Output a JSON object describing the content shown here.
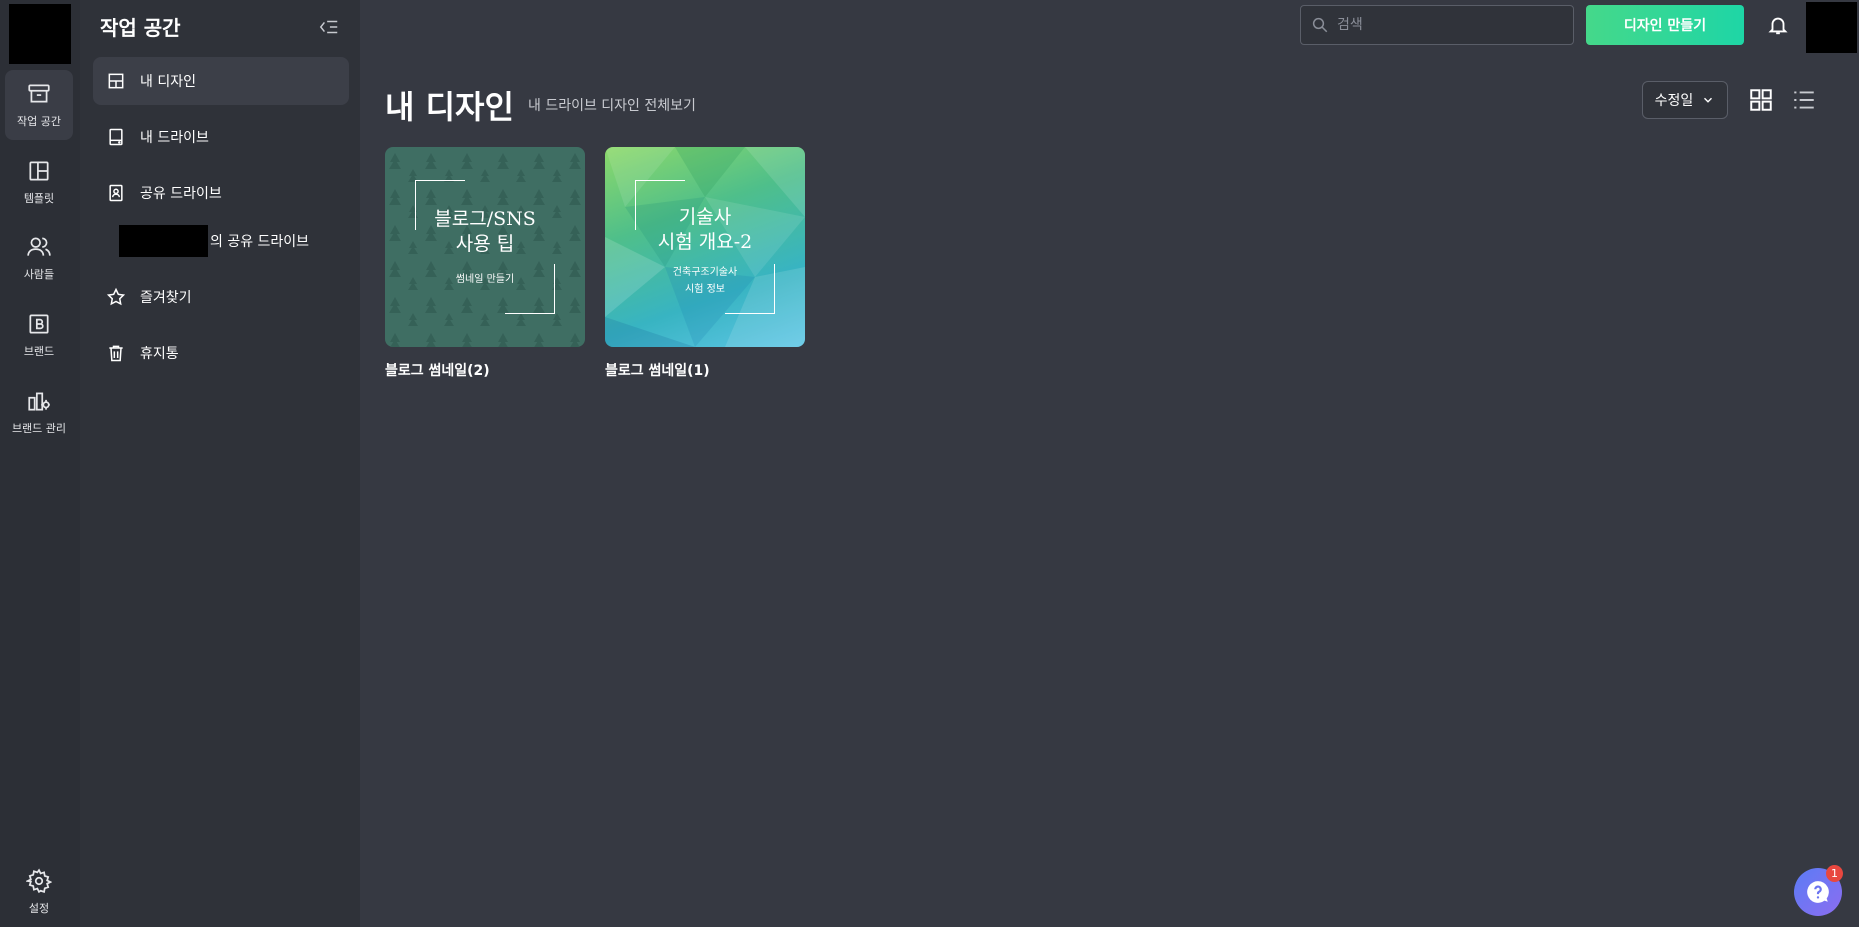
{
  "rail": {
    "items": [
      {
        "label": "작업 공간"
      },
      {
        "label": "템플릿"
      },
      {
        "label": "사람들"
      },
      {
        "label": "브랜드"
      },
      {
        "label": "브랜드 관리"
      }
    ],
    "settings_label": "설정"
  },
  "sidebar": {
    "title": "작업 공간",
    "items": [
      {
        "label": "내 디자인"
      },
      {
        "label": "내 드라이브"
      },
      {
        "label": "공유 드라이브"
      },
      {
        "label": "의 공유 드라이브"
      },
      {
        "label": "즐겨찾기"
      },
      {
        "label": "휴지통"
      }
    ]
  },
  "header": {
    "search_placeholder": "검색",
    "create_button": "디자인 만들기"
  },
  "main": {
    "title": "내 디자인",
    "subtitle": "내 드라이브 디자인 전체보기",
    "sort_label": "수정일",
    "designs": [
      {
        "name": "블로그 썸네일(2)",
        "headline": [
          "블로그/SNS",
          "사용 팁"
        ],
        "subline": [
          "썸네일 만들기"
        ]
      },
      {
        "name": "블로그 썸네일(1)",
        "headline": [
          "기술사",
          "시험 개요-2"
        ],
        "subline": [
          "건축구조기술사",
          "시험 정보"
        ]
      }
    ]
  },
  "help": {
    "badge": "1"
  },
  "colors": {
    "background": "#363942",
    "rail": "#2c2f36",
    "panel": "#2f3239",
    "accent_start": "#45d88a",
    "accent_end": "#1ed6a6",
    "badge": "#e8473f"
  }
}
